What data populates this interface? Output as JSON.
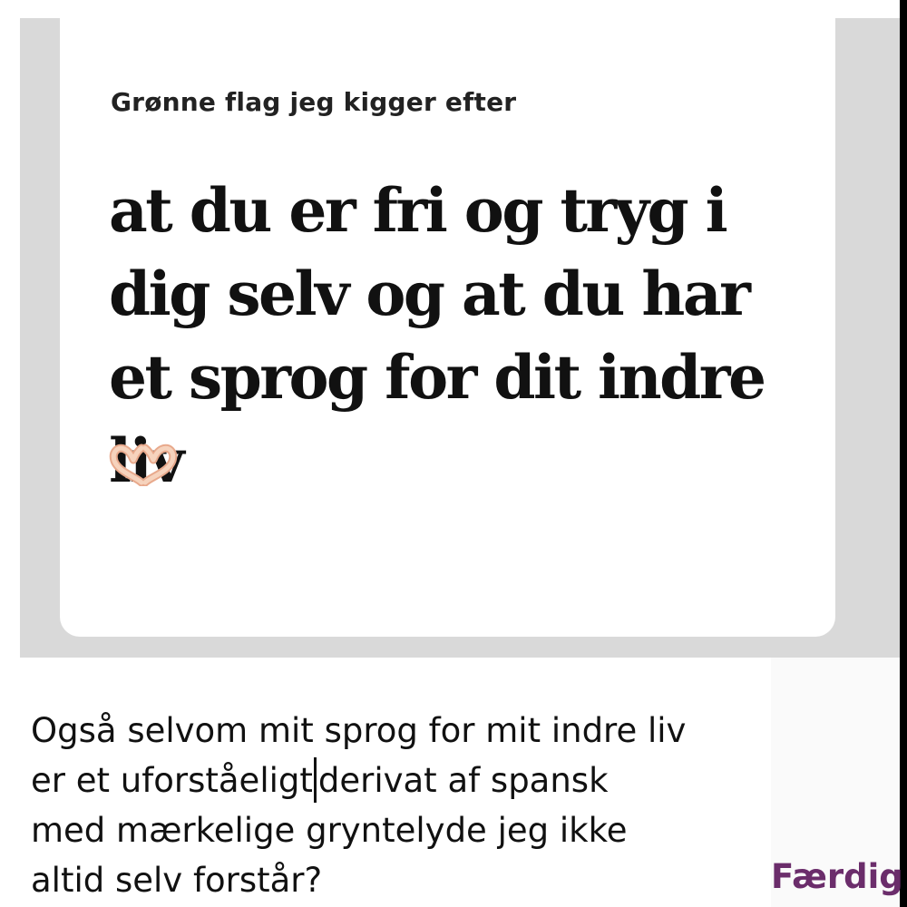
{
  "prompt": {
    "label": "Grønne flag jeg kigger efter",
    "answer": "at du er fri og tryg i dig selv og at du har et sprog for dit indre liv",
    "emoji_icon": "heart-hands-icon"
  },
  "reply": {
    "line1": "Også selvom mit sprog for mit indre liv",
    "line2_before_cursor": "er et uforståeligt",
    "line2_after_cursor": "derivat af spansk",
    "line3": "med mærkelige gryntelyde jeg ikke",
    "line4": "altid selv forstår?"
  },
  "actions": {
    "done_label": "Færdig"
  },
  "colors": {
    "accent": "#6b2d6b",
    "background_gray": "#d9d9d9",
    "card": "#ffffff",
    "text": "#111111"
  }
}
